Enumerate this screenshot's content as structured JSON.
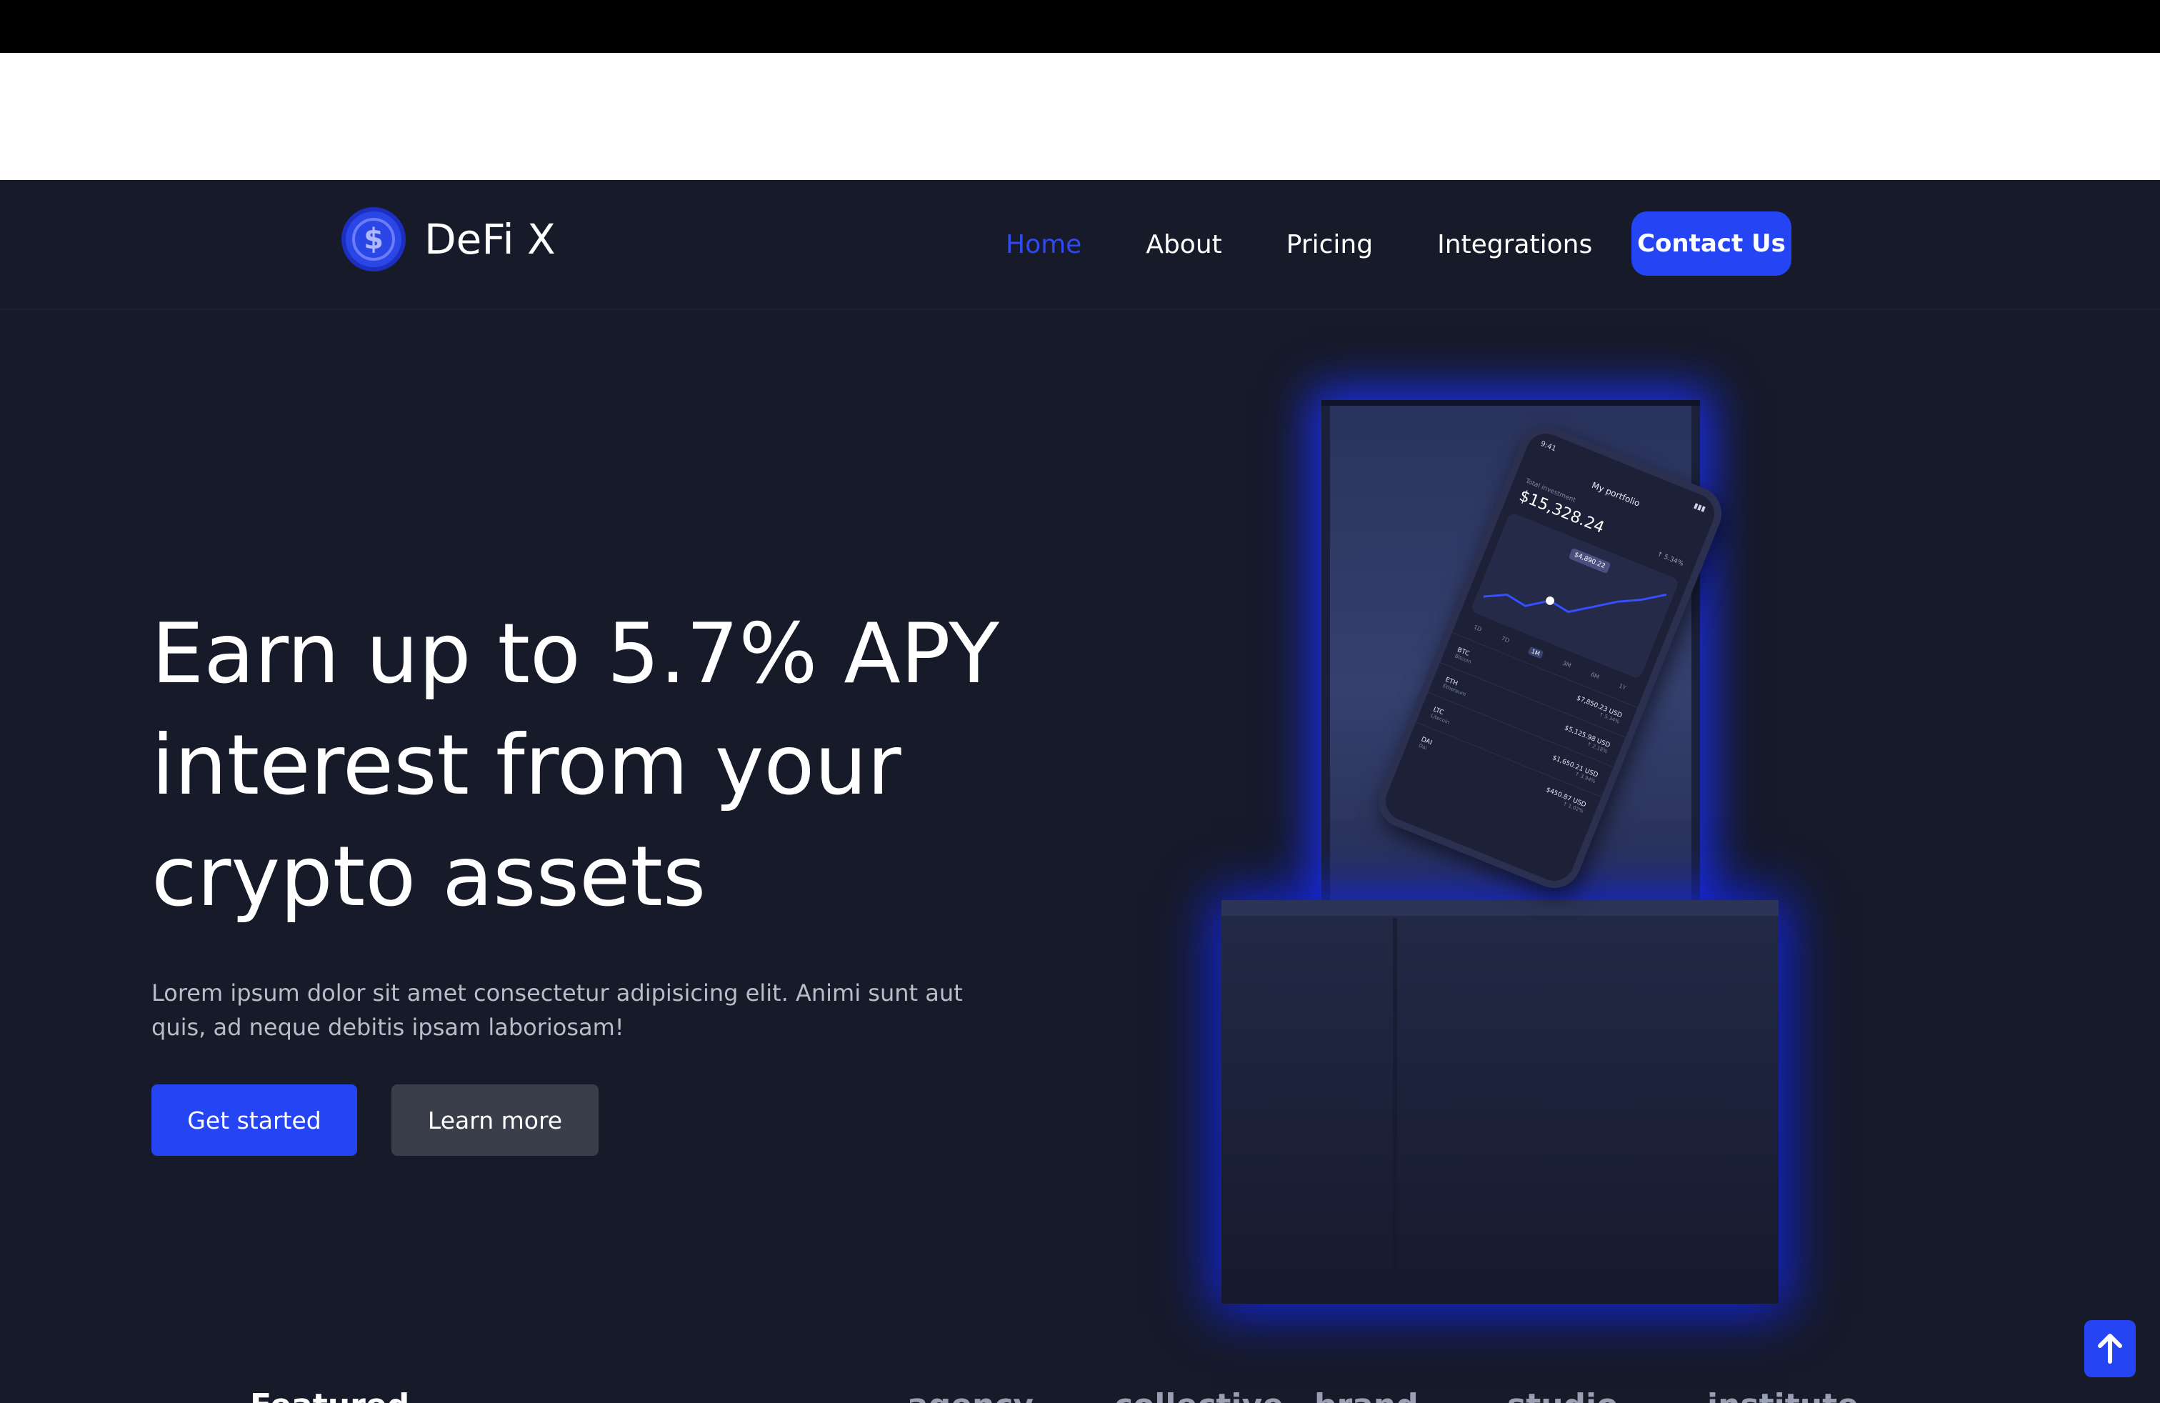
{
  "brand": {
    "name": "DeFi X",
    "icon": "dollar-coin-icon",
    "accent": "#2544f4"
  },
  "nav": {
    "items": [
      {
        "label": "Home",
        "active": true
      },
      {
        "label": "About",
        "active": false
      },
      {
        "label": "Pricing",
        "active": false
      },
      {
        "label": "Integrations",
        "active": false
      }
    ],
    "contact_label": "Contact Us"
  },
  "hero": {
    "title_lines": [
      "Earn up to 5.7% APY",
      "interest from your",
      "crypto assets"
    ],
    "description": "Lorem ipsum dolor sit amet consectetur adipisicing elit. Animi sunt aut quis, ad neque debitis ipsam laboriosam!",
    "primary_button": "Get started",
    "secondary_button": "Learn more"
  },
  "phone_mockup": {
    "time": "9:41",
    "title": "My portfolio",
    "total_label": "Total investment",
    "total_value": "$15,328.24",
    "change": "↑ 5.34%",
    "chart_tooltip": "$4,890.22",
    "ranges": [
      "1D",
      "7D",
      "1M",
      "3M",
      "6M",
      "1Y"
    ],
    "selected_range": "1M",
    "assets": [
      {
        "symbol": "BTC",
        "name": "Bitcoin",
        "value": "$7,850.23 USD",
        "change": "↑ 5.34%"
      },
      {
        "symbol": "ETH",
        "name": "Ethereum",
        "value": "$5,125.98 USD",
        "change": "↑ 2.18%"
      },
      {
        "symbol": "LTC",
        "name": "Litecoin",
        "value": "$1,650.21 USD",
        "change": "↑ 3.94%"
      },
      {
        "symbol": "DAI",
        "name": "Dai",
        "value": "$450.87 USD",
        "change": "↑ 1.02%"
      }
    ]
  },
  "partners": {
    "title": "Featured",
    "logos": [
      "agency",
      "collective",
      "brand",
      "studio",
      "institute"
    ]
  },
  "scroll_top_icon": "arrow-up-icon"
}
